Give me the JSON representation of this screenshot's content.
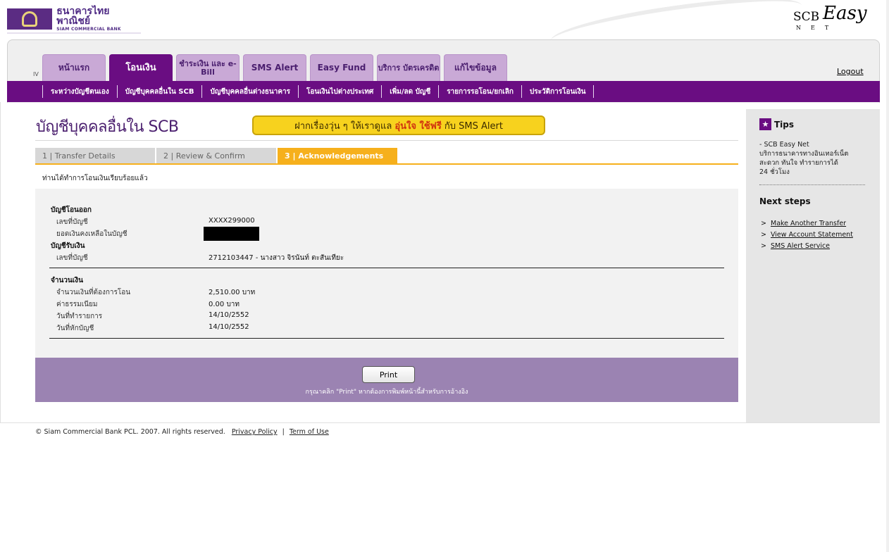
{
  "brand": {
    "bank_name_th": "ธนาคารไทยพาณิชย์",
    "bank_name_en": "SIAM COMMERCIAL BANK",
    "product_scb": "SCB",
    "product_easy": "Easy",
    "product_net": "NET"
  },
  "nav": {
    "indicator": "IV",
    "tabs": [
      {
        "label": "หน้าแรก"
      },
      {
        "label": "โอนเงิน"
      },
      {
        "label": "ชำระเงิน และ e-Bill"
      },
      {
        "label": "SMS Alert"
      },
      {
        "label": "Easy Fund"
      },
      {
        "label": "บริการ บัตรเครดิต"
      },
      {
        "label": "แก้ไขข้อมูล"
      }
    ],
    "logout": "Logout",
    "subnav": [
      {
        "label": "ระหว่างบัญชีตนเอง"
      },
      {
        "label": "บัญชีบุคคลอื่นใน SCB"
      },
      {
        "label": "บัญชีบุคคลอื่นต่างธนาคาร"
      },
      {
        "label": "โอนเงินไปต่างประเทศ"
      },
      {
        "label": "เพิ่ม/ลด บัญชี"
      },
      {
        "label": "รายการรอโอน/ยกเลิก"
      },
      {
        "label": "ประวัติการโอนเงิน"
      }
    ]
  },
  "main": {
    "page_title": "บัญชีบุคคลอื่นใน SCB",
    "banner": {
      "part1": "ฝากเรื่องวุ่น ๆ ให้เราดูแล",
      "highlight": "อุ่นใจ ใช้ฟรี",
      "part2": "กับ SMS Alert"
    },
    "steps": [
      {
        "label": "1 | Transfer Details"
      },
      {
        "label": "2 | Review & Confirm"
      },
      {
        "label": "3 | Acknowledgements"
      }
    ],
    "success_message": "ท่านได้ทำการโอนเงินเรียบร้อยแล้ว",
    "from_account": {
      "heading": "บัญชีโอนออก",
      "account_no_label": "เลขที่บัญชี",
      "account_no": "XXXX299000",
      "balance_label": "ยอดเงินคงเหลือในบัญชี"
    },
    "to_account": {
      "heading": "บัญชีรับเงิน",
      "account_no_label": "เลขที่บัญชี",
      "account_no": "2712103447 - นางสาว จิรนันท์ ตะสันเทียะ"
    },
    "amount": {
      "heading": "จำนวนเงิน",
      "amount_label": "จำนวนเงินที่ต้องการโอน",
      "amount_value": "2,510.00 บาท",
      "fee_label": "ค่าธรรมเนียม",
      "fee_value": "0.00 บาท",
      "txn_date_label": "วันที่ทำรายการ",
      "txn_date_value": "14/10/2552",
      "debit_date_label": "วันที่หักบัญชี",
      "debit_date_value": "14/10/2552"
    },
    "print_button": "Print",
    "print_hint": "กรุณาคลิก \"Print\" หากต้องการพิมพ์หน้านี้สำหรับการอ้างอิง"
  },
  "sidebar": {
    "tips_icon": "star-icon",
    "tips_heading": "Tips",
    "tips_line1": "- SCB Easy Net",
    "tips_line2": "บริการธนาคารทางอินเทอร์เน็ต",
    "tips_line3": "สะดวก ทันใจ ทำรายการได้",
    "tips_line4": "24 ชั่วโมง",
    "next_heading": "Next steps",
    "next_links": [
      {
        "label": "Make Another Transfer"
      },
      {
        "label": "View Account Statement"
      },
      {
        "label": "SMS Alert Service"
      }
    ]
  },
  "footer": {
    "copyright": "© Siam Commercial Bank PCL. 2007. All rights reserved.",
    "privacy": "Privacy Policy",
    "terms": "Term of Use"
  },
  "colors": {
    "brand_purple": "#6a0d82",
    "tab_light": "#c9a9d6",
    "step_active": "#f6b01c",
    "print_bar": "#9b83b2"
  }
}
